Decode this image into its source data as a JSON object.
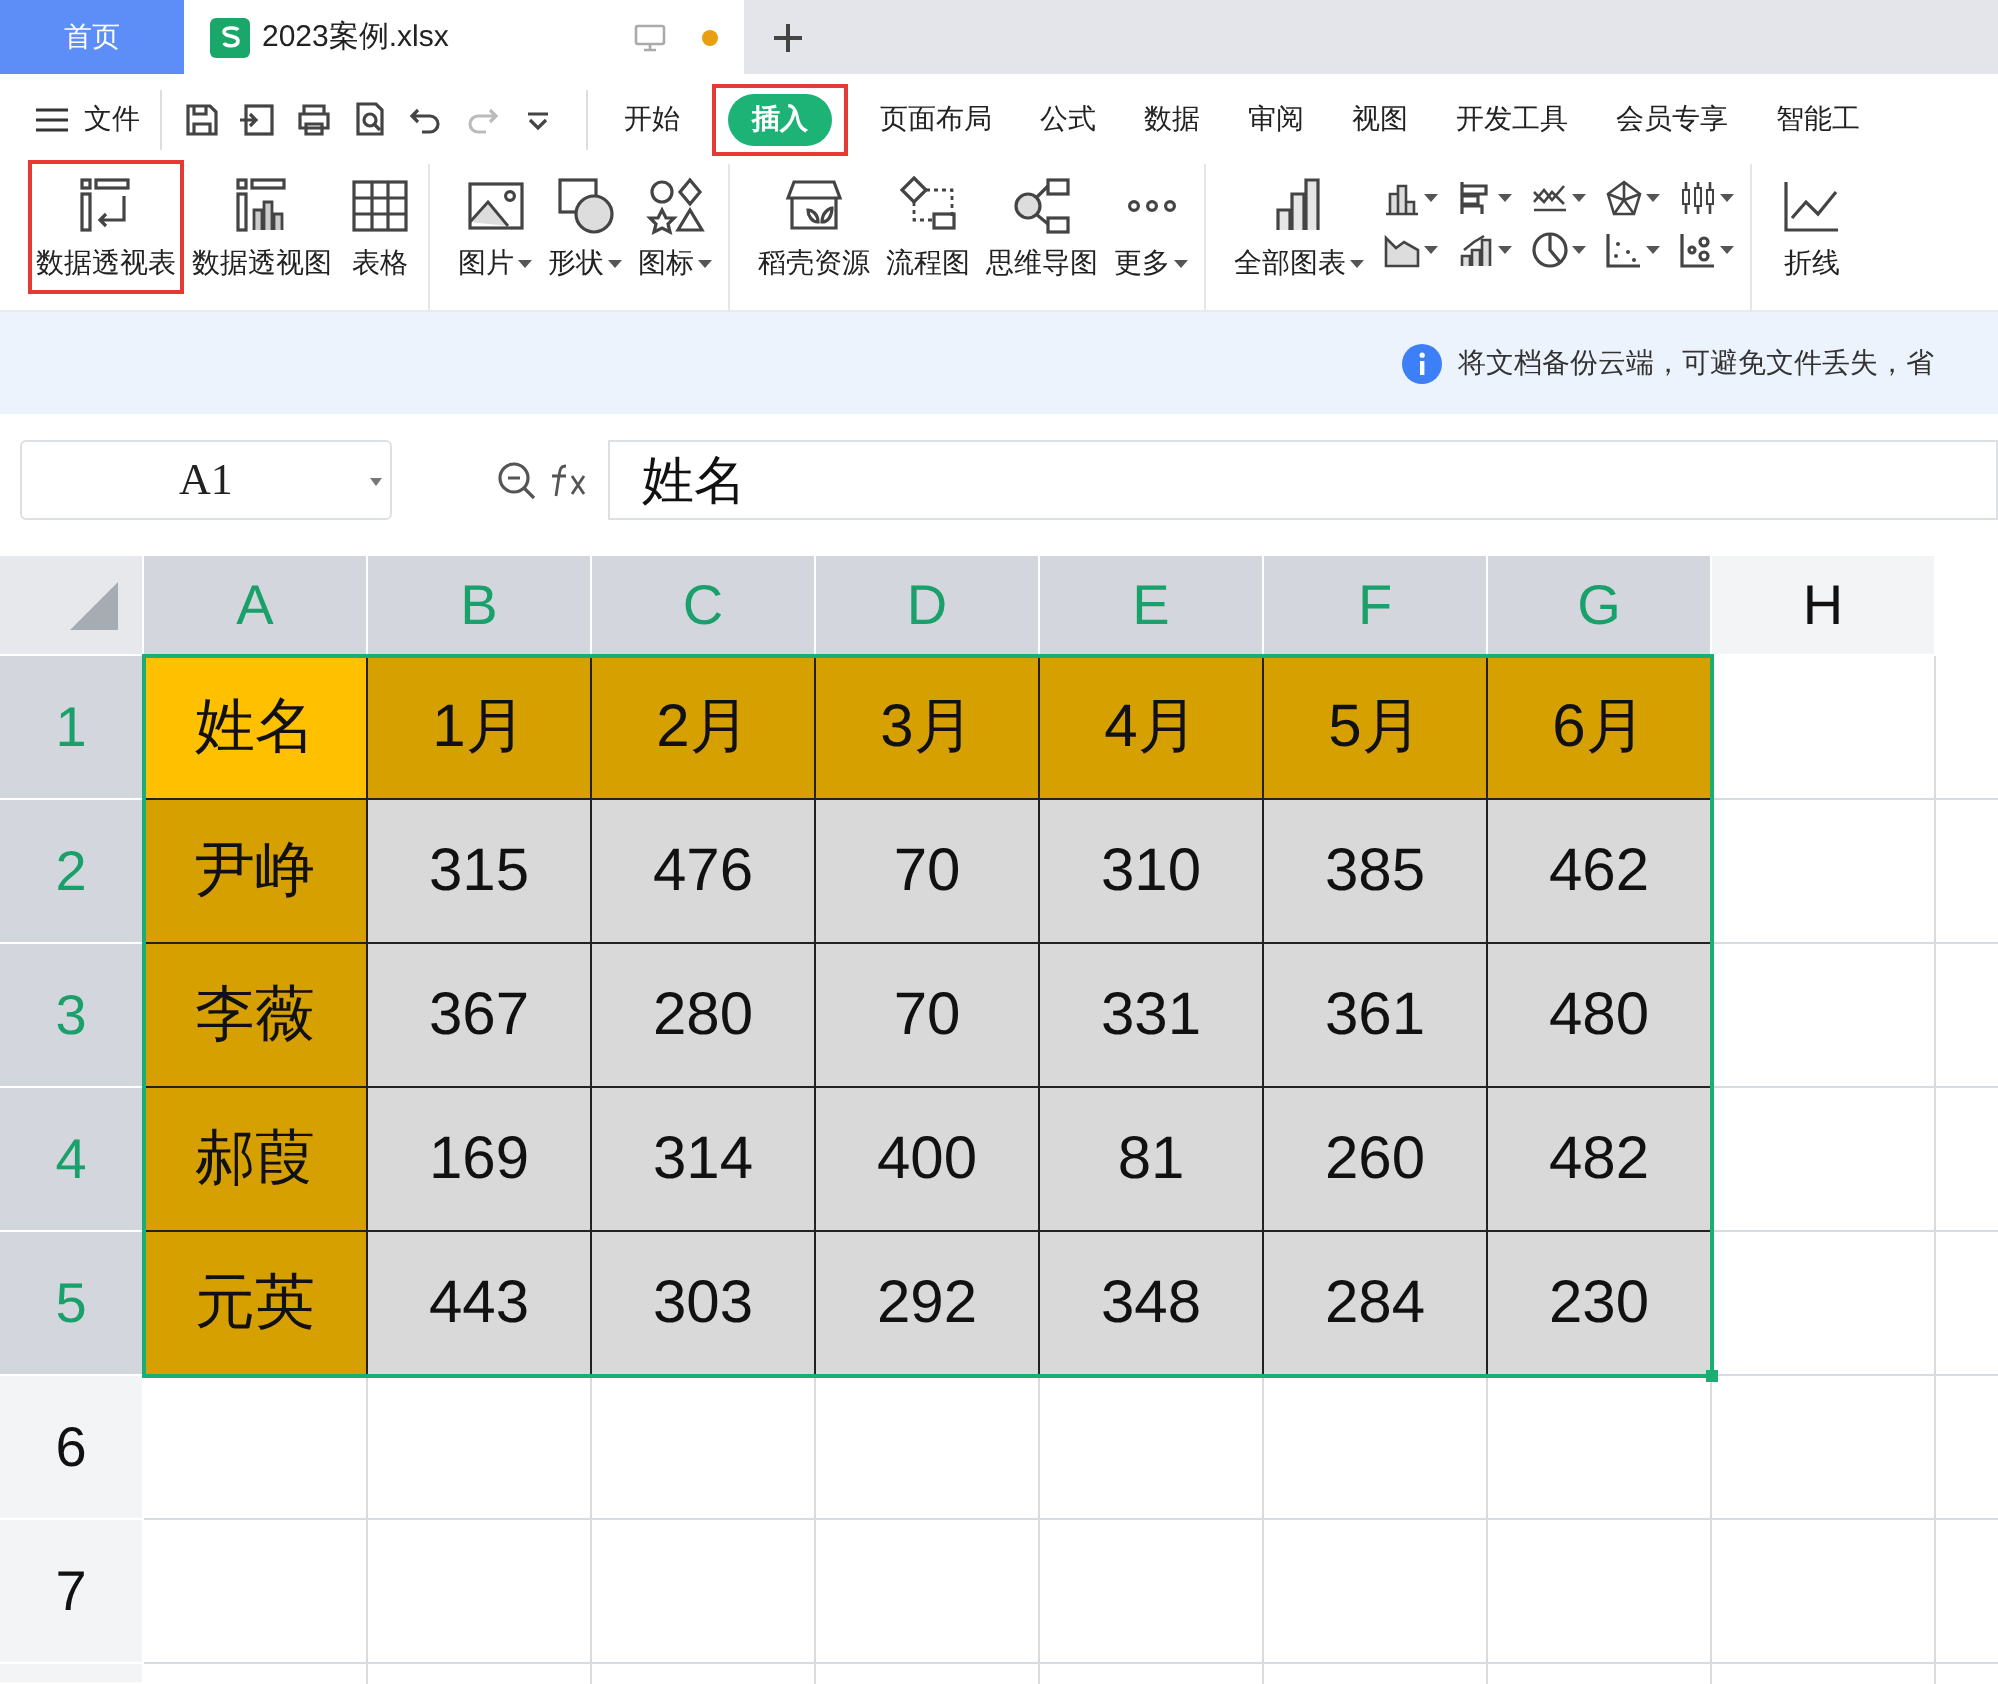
{
  "doc_tabs": [
    {
      "label": "首页",
      "kind": "home",
      "selected": false,
      "unsaved": false
    },
    {
      "label": "2023案例.xlsx",
      "kind": "file",
      "selected": true,
      "unsaved": true
    }
  ],
  "menu": {
    "file_label": "文件",
    "tabs": [
      {
        "label": "开始",
        "selected": false,
        "annotated": false
      },
      {
        "label": "插入",
        "selected": true,
        "annotated": true
      },
      {
        "label": "页面布局",
        "selected": false,
        "annotated": false
      },
      {
        "label": "公式",
        "selected": false,
        "annotated": false
      },
      {
        "label": "数据",
        "selected": false,
        "annotated": false
      },
      {
        "label": "审阅",
        "selected": false,
        "annotated": false
      },
      {
        "label": "视图",
        "selected": false,
        "annotated": false
      },
      {
        "label": "开发工具",
        "selected": false,
        "annotated": false
      },
      {
        "label": "会员专享",
        "selected": false,
        "annotated": false
      },
      {
        "label": "智能工",
        "selected": false,
        "annotated": false
      }
    ]
  },
  "ribbon": {
    "groups": [
      {
        "chart_gallery": false,
        "items": [
          {
            "label": "数据透视表",
            "dropdown": false,
            "annotated": true
          },
          {
            "label": "数据透视图",
            "dropdown": false,
            "annotated": false
          },
          {
            "label": "表格",
            "dropdown": false,
            "annotated": false
          }
        ]
      },
      {
        "chart_gallery": false,
        "items": [
          {
            "label": "图片",
            "dropdown": true,
            "annotated": false
          },
          {
            "label": "形状",
            "dropdown": true,
            "annotated": false
          },
          {
            "label": "图标",
            "dropdown": true,
            "annotated": false
          }
        ]
      },
      {
        "chart_gallery": false,
        "items": [
          {
            "label": "稻壳资源",
            "dropdown": false,
            "annotated": false
          },
          {
            "label": "流程图",
            "dropdown": false,
            "annotated": false
          },
          {
            "label": "思维导图",
            "dropdown": false,
            "annotated": false
          },
          {
            "label": "更多",
            "dropdown": true,
            "annotated": false
          }
        ]
      },
      {
        "chart_gallery": true,
        "items": [
          {
            "label": "全部图表",
            "dropdown": true,
            "annotated": false
          }
        ]
      },
      {
        "chart_gallery": false,
        "items": [
          {
            "label": "折线",
            "dropdown": false,
            "annotated": false
          }
        ]
      }
    ]
  },
  "notice": {
    "text": "将文档备份云端，可避免文件丢失，省"
  },
  "formula_bar": {
    "cell_ref": "A1",
    "formula": "姓名"
  },
  "sheet": {
    "columns": [
      {
        "label": "A",
        "selected": true
      },
      {
        "label": "B",
        "selected": true
      },
      {
        "label": "C",
        "selected": true
      },
      {
        "label": "D",
        "selected": true
      },
      {
        "label": "E",
        "selected": true
      },
      {
        "label": "F",
        "selected": true
      },
      {
        "label": "G",
        "selected": true
      },
      {
        "label": "H",
        "selected": false
      }
    ],
    "rows": [
      {
        "label": "1",
        "selected": true,
        "cells": [
          "姓名",
          "1月",
          "2月",
          "3月",
          "4月",
          "5月",
          "6月"
        ]
      },
      {
        "label": "2",
        "selected": true,
        "cells": [
          "尹峥",
          "315",
          "476",
          "70",
          "310",
          "385",
          "462"
        ]
      },
      {
        "label": "3",
        "selected": true,
        "cells": [
          "李薇",
          "367",
          "280",
          "70",
          "331",
          "361",
          "480"
        ]
      },
      {
        "label": "4",
        "selected": true,
        "cells": [
          "郝葭",
          "169",
          "314",
          "400",
          "81",
          "260",
          "482"
        ]
      },
      {
        "label": "5",
        "selected": true,
        "cells": [
          "元英",
          "443",
          "303",
          "292",
          "348",
          "284",
          "230"
        ]
      },
      {
        "label": "6",
        "selected": false
      },
      {
        "label": "7",
        "selected": false
      }
    ]
  }
}
